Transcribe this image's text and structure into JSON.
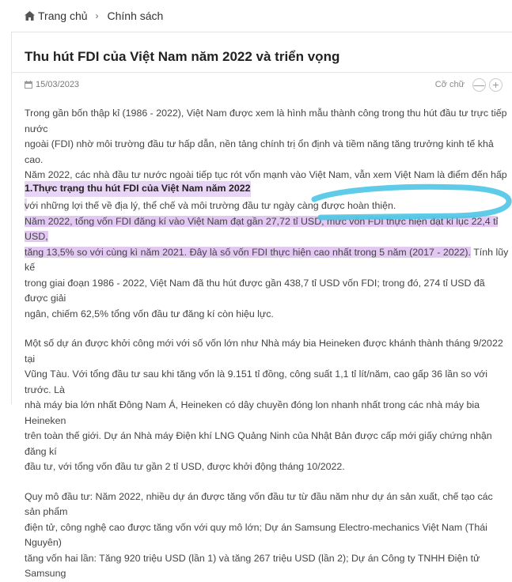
{
  "breadcrumb": {
    "home": "Trang chủ",
    "section": "Chính sách"
  },
  "article": {
    "title": "Thu hút FDI của Việt Nam năm 2022 và triển vọng",
    "date": "15/03/2023",
    "font_size_label": "Cỡ chữ",
    "font_decrease": "—",
    "font_increase": "+",
    "intro_lines": [
      "Trong gần bốn thập kỉ (1986 - 2022), Việt Nam được xem là hình mẫu thành công trong thu hút đầu tư trực tiếp nước",
      "ngoài (FDI) nhờ môi trường đầu tư hấp dẫn, nền tảng chính trị ổn định và tiềm năng tăng trưởng kinh tế khả cao.",
      "Năm 2022, các nhà đầu tư nước ngoài tiếp tục rót vốn mạnh vào Việt Nam, vẫn xem Việt Nam là điểm đến hấp dẫn",
      "với những lợi thế về địa lý, thể chế và môi trường đầu tư ngày càng được hoàn thiện."
    ],
    "section1_heading": "1.Thực trạng thu hút FDI của Việt Nam năm 2022",
    "p2_hl1": "Năm 2022, tổng vốn FDI đăng kí vào Việt Nam đạt gần 27,72 tỉ USD, mức vốn FDI thực hiện đạt kỉ lục 22,4 tỉ USD,",
    "p2_hl2": "tăng 13,5% so với cùng kì năm 2021. Đây là số vốn FDI thực hiện cao nhất trong 5 năm (2017 - 2022).",
    "p2_rest2": " Tính lũy kế",
    "p2_line3": "trong giai đoạn 1986 - 2022, Việt Nam đã thu hút được gần 438,7 tỉ USD vốn FDI; trong đó, 274 tỉ USD đã được giải",
    "p2_line4": "ngân, chiếm 62,5% tổng vốn đầu tư đăng kí còn hiệu lực.",
    "p3_lines": [
      "Một số dự án được khởi công mới với số vốn lớn như Nhà máy bia Heineken được khánh thành tháng 9/2022 tại",
      "Vũng Tàu. Với tổng đầu tư sau khi tăng vốn là 9.151 tỉ đồng, công suất 1,1 tỉ lít/năm, cao gấp 36 lần so với trước. Là",
      "nhà máy bia lớn nhất Đông Nam Á, Heineken có dây chuyền đóng lon nhanh nhất trong các nhà máy bia Heineken",
      "trên toàn thế giới. Dự án Nhà máy Điện khí LNG Quảng Ninh của Nhật Bản được cấp mới giấy chứng nhận đăng kí",
      "đầu tư, với tổng vốn đầu tư gần 2 tỉ USD, được khởi động tháng 10/2022."
    ],
    "p4_lines": [
      "Quy mô đầu tư: Năm 2022, nhiều dự án được tăng vốn đầu tư từ đầu năm như dự án sản xuất, chế tạo các sản phẩm",
      "điện tử, công nghệ cao được tăng vốn với quy mô lớn;  Dự án Samsung Electro-mechanics Việt Nam (Thái Nguyên)",
      "tăng vốn hai lần: Tăng 920 triệu USD (lần 1) và tăng 267 triệu USD (lần 2); Dự án Công ty TNHH Điện tử Samsung"
    ]
  },
  "colors": {
    "highlight": "#e2c8f3",
    "marker": "#4cc6e6"
  }
}
